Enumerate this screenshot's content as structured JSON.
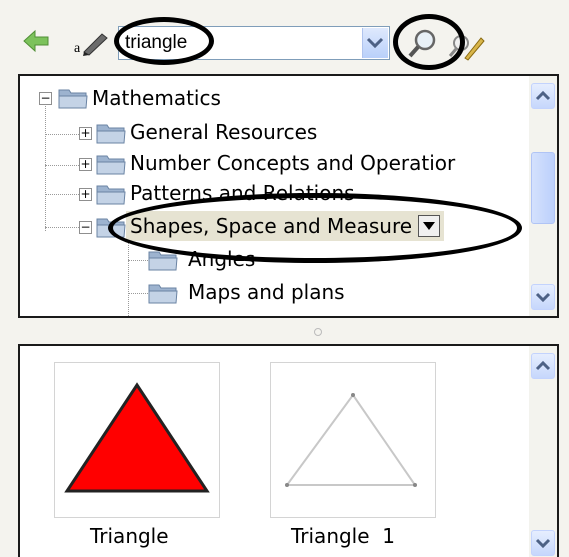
{
  "toolbar": {
    "search_value": "triangle",
    "back_icon": "back-arrow-icon",
    "edit_icon": "pencil-icon",
    "find_icon": "magnifier-icon",
    "clear_icon": "clear-search-icon"
  },
  "tree": {
    "root": "Mathematics",
    "items": [
      {
        "label": "General Resources"
      },
      {
        "label": "Number Concepts and Operatior"
      },
      {
        "label": "Patterns and Relations"
      },
      {
        "label": "Shapes, Space and Measure"
      }
    ],
    "children": [
      {
        "label": "Angles"
      },
      {
        "label": "Maps and plans"
      }
    ]
  },
  "results": [
    {
      "caption": "Triangle"
    },
    {
      "caption": "Triangle  1"
    }
  ],
  "colors": {
    "annotation": "#000000",
    "selection": "#e6e3d2",
    "red_triangle": "#ff0000",
    "scroll_accent": "#c6d7fc"
  }
}
